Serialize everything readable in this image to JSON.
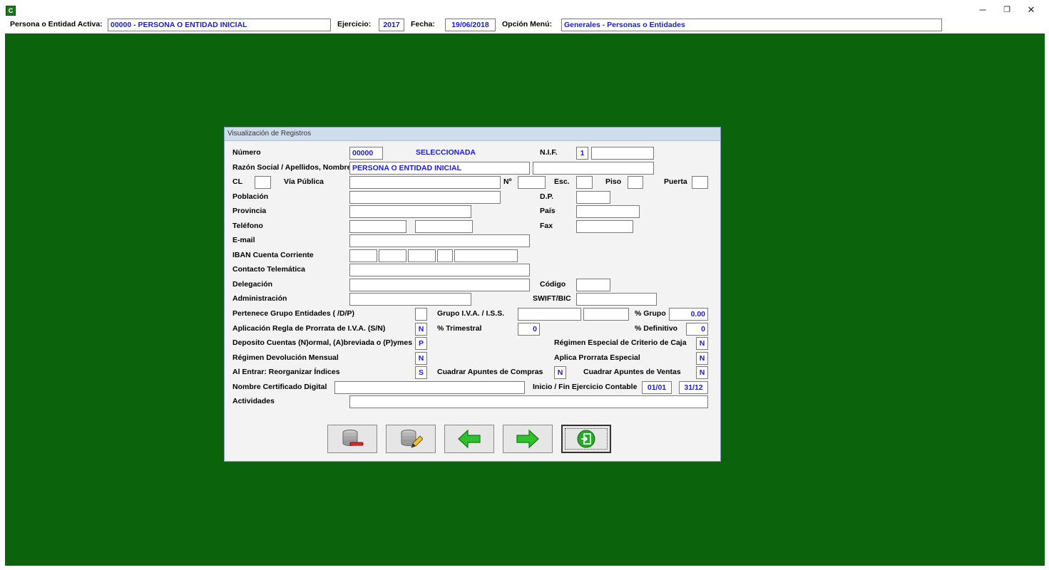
{
  "app": {
    "icon_letter": "C",
    "persona_label": "Persona o Entidad Activa:",
    "persona_value": "00000 - PERSONA O ENTIDAD INICIAL",
    "ejercicio_label": "Ejercicio:",
    "ejercicio_value": "2017",
    "fecha_label": "Fecha:",
    "fecha_value": "19/06/2018",
    "opcion_label": "Opción Menú:",
    "opcion_value": "Generales - Personas o Entidades",
    "minimize": "─",
    "restore": "❐",
    "close": "✕"
  },
  "dialog": {
    "title": "Visualización de Registros",
    "labels": {
      "numero": "Número",
      "seleccionada": "SELECCIONADA",
      "nif": "N.I.F.",
      "razon": "Razón Social / Apellidos, Nombre",
      "cl": "CL",
      "via": "Vía Pública",
      "no": "Nº",
      "esc": "Esc.",
      "piso": "Piso",
      "puerta": "Puerta",
      "poblacion": "Población",
      "dp": "D.P.",
      "provincia": "Provincia",
      "pais": "País",
      "telefono": "Teléfono",
      "fax": "Fax",
      "email": "E-mail",
      "iban": "IBAN Cuenta Corriente",
      "contacto": "Contacto Telemática",
      "delegacion": "Delegación",
      "codigo": "Código",
      "administracion": "Administración",
      "swift": "SWIFT/BIC",
      "grupo_ent": "Pertenece Grupo Entidades ( /D/P)",
      "grupo_iva": "Grupo I.V.A. / I.S.S.",
      "pct_grupo": "% Grupo",
      "prorrata": "Aplicación Regla de Prorrata de I.V.A. (S/N)",
      "trimestral": "% Trimestral",
      "definitivo": "% Definitivo",
      "deposito": "Deposito Cuentas (N)ormal, (A)breviada o (P)ymes",
      "criterio_caja": "Régimen Especial de Criterio de Caja",
      "devolucion": "Régimen Devolución Mensual",
      "prorrata_esp": "Aplica Prorrata Especial",
      "reorganizar": "Al Entrar: Reorganizar Índices",
      "cuadrar_compras": "Cuadrar Apuntes de Compras",
      "cuadrar_ventas": "Cuadrar Apuntes de Ventas",
      "certificado": "Nombre Certificado Digital",
      "inicio_fin": "Inicio / Fin Ejercicio Contable",
      "actividades": "Actividades"
    },
    "values": {
      "numero": "00000",
      "nif_tipo": "1",
      "nif": "",
      "razon": "PERSONA O ENTIDAD INICIAL",
      "razon2": "",
      "cl": "",
      "via": "",
      "no": "",
      "esc": "",
      "piso": "",
      "puerta": "",
      "poblacion": "",
      "dp": "",
      "provincia": "",
      "pais": "",
      "telefono1": "",
      "telefono2": "",
      "fax": "",
      "email": "",
      "iban1": "",
      "iban2": "",
      "iban3": "",
      "iban4": "",
      "iban5": "",
      "contacto": "",
      "delegacion": "",
      "codigo": "",
      "administracion": "",
      "swift": "",
      "grupo_ent": "",
      "grupo_iva1": "",
      "grupo_iva2": "",
      "pct_grupo": "0.00",
      "prorrata": "N",
      "trimestral": "0",
      "definitivo": "0",
      "deposito": "P",
      "criterio_caja": "N",
      "devolucion": "N",
      "prorrata_esp": "N",
      "reorganizar": "S",
      "cuadrar_compras": "N",
      "cuadrar_ventas": "N",
      "certificado": "",
      "inicio": "01/01",
      "fin": "31/12",
      "actividades": ""
    },
    "buttons": [
      {
        "name": "delete-record",
        "icon": "database-delete-icon"
      },
      {
        "name": "edit-record",
        "icon": "database-edit-icon"
      },
      {
        "name": "previous-record",
        "icon": "arrow-left-icon"
      },
      {
        "name": "next-record",
        "icon": "arrow-right-icon"
      },
      {
        "name": "exit",
        "icon": "exit-icon"
      }
    ]
  },
  "colors": {
    "desktop_green": "#0b640b",
    "dialog_bg": "#f3f3f3",
    "title_bar": "#cfdcec",
    "field_text": "#1a1ad6",
    "arrow_green": "#2fbf2f"
  }
}
